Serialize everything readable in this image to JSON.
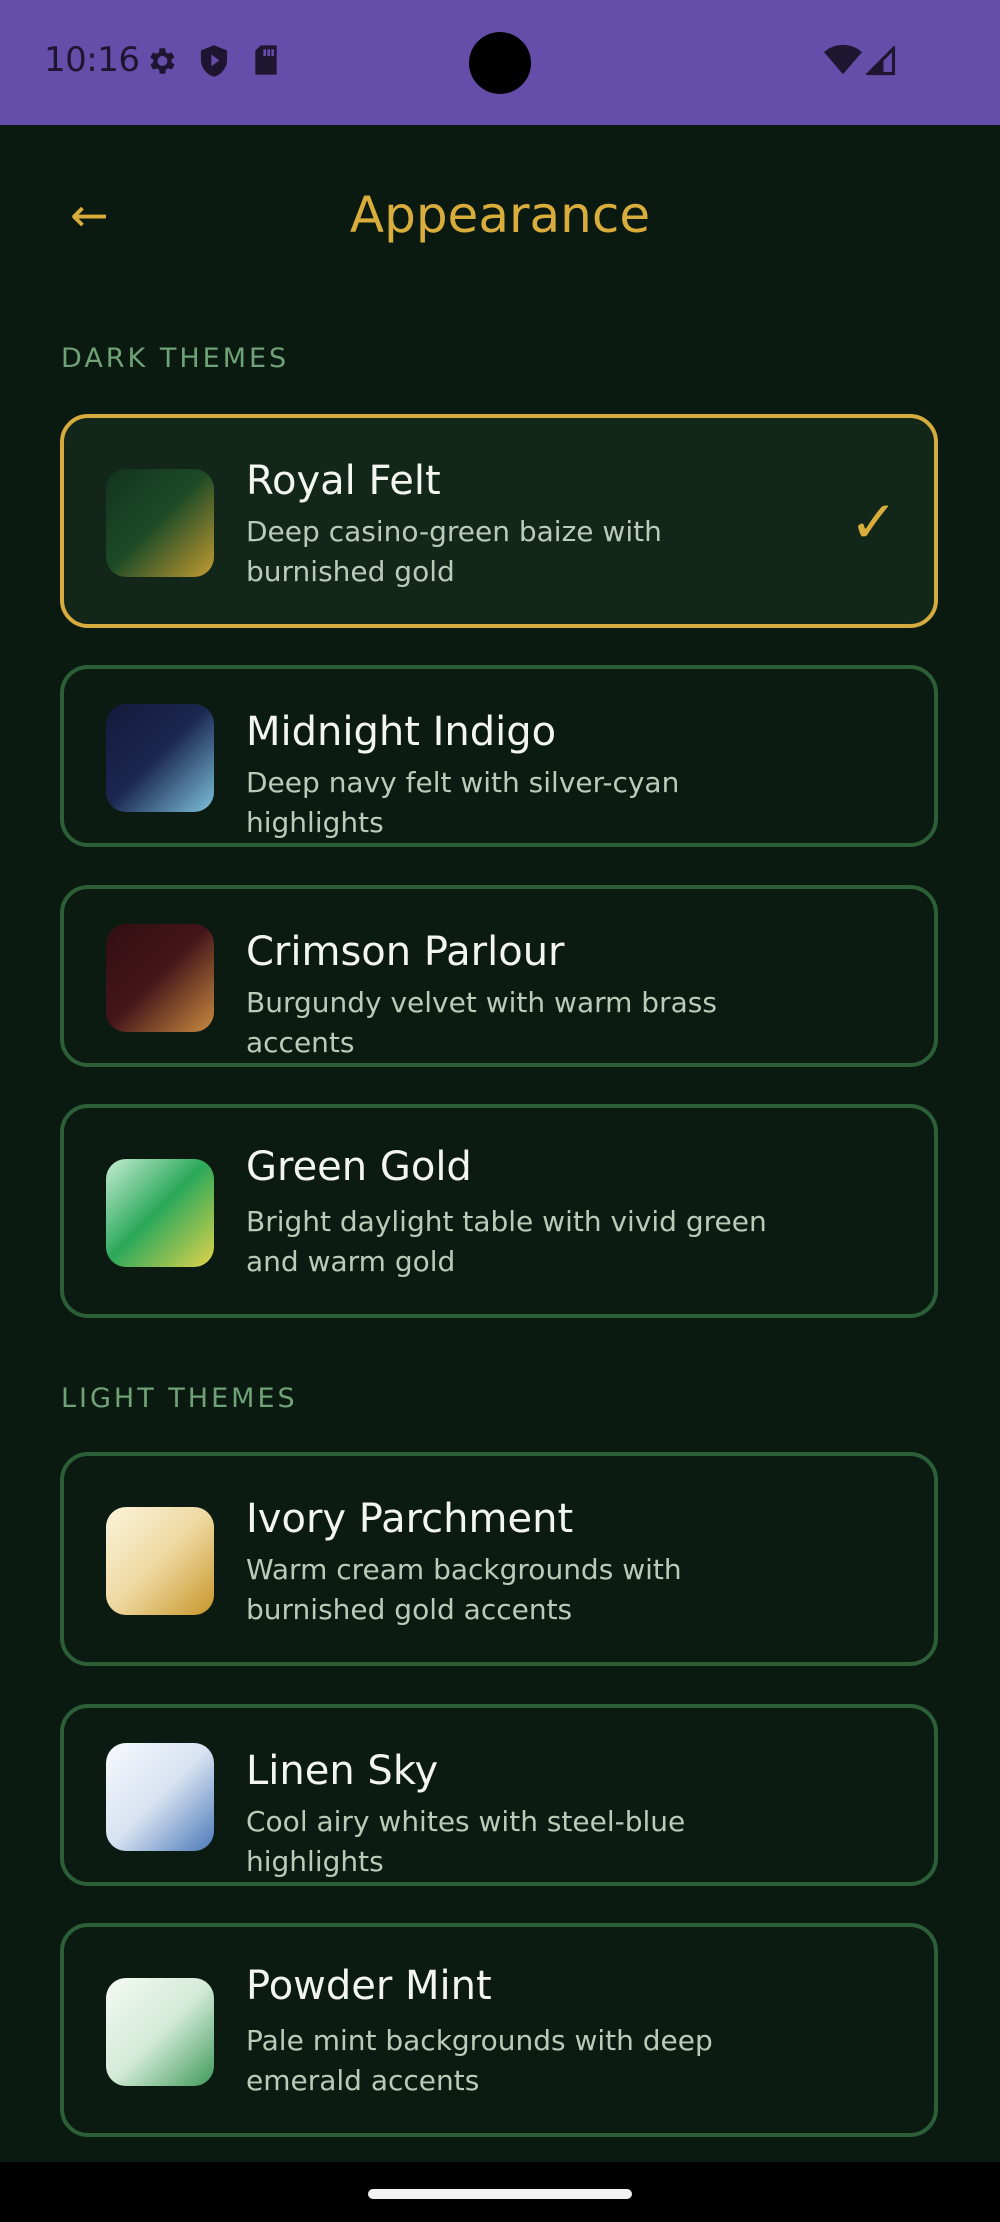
{
  "status_bar": {
    "time": "10:16",
    "icons": [
      "gear-icon",
      "shield-icon",
      "sd-card-icon",
      "wifi-icon",
      "signal-icon"
    ]
  },
  "header": {
    "back_icon": "arrow-left-icon",
    "back_glyph": "←",
    "title": "Appearance"
  },
  "sections": {
    "dark_label": "DARK THEMES",
    "light_label": "LIGHT THEMES"
  },
  "colors": {
    "accent": "#d9ad3c",
    "background": "#0b1a10",
    "card_border": "#2c5e38",
    "status_bar": "#644eaa"
  },
  "themes": {
    "dark": [
      {
        "name": "Royal Felt",
        "description": "Deep casino-green baize with burnished gold",
        "selected": true,
        "check": "✓"
      },
      {
        "name": "Midnight Indigo",
        "description": "Deep navy felt with silver-cyan highlights",
        "selected": false
      },
      {
        "name": "Crimson Parlour",
        "description": "Burgundy velvet with warm brass accents",
        "selected": false
      },
      {
        "name": "Green Gold",
        "description": "Bright daylight table with vivid green and warm gold",
        "selected": false
      }
    ],
    "light": [
      {
        "name": "Ivory Parchment",
        "description": "Warm cream backgrounds with burnished gold accents",
        "selected": false
      },
      {
        "name": "Linen Sky",
        "description": "Cool airy whites with steel-blue highlights",
        "selected": false
      },
      {
        "name": "Powder Mint",
        "description": "Pale mint backgrounds with deep emerald accents",
        "selected": false
      }
    ]
  }
}
